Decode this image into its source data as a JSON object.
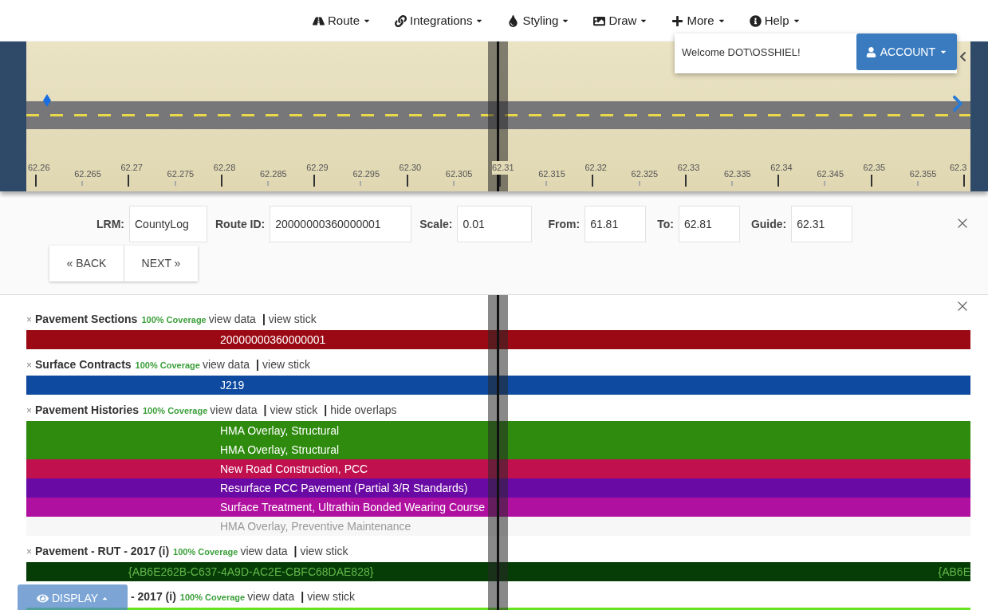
{
  "nav": [
    {
      "label": "Route"
    },
    {
      "label": "Integrations"
    },
    {
      "label": "Styling"
    },
    {
      "label": "Draw"
    },
    {
      "label": "More"
    },
    {
      "label": "Help"
    }
  ],
  "account": {
    "welcome": "Welcome DOT\\OSSHIEL!",
    "button": "ACCOUNT"
  },
  "map": {
    "ticks": [
      {
        "label": "62.26",
        "kind": "major"
      },
      {
        "label": "62.265",
        "kind": "minor"
      },
      {
        "label": "62.27",
        "kind": "major"
      },
      {
        "label": "62.275",
        "kind": "minor"
      },
      {
        "label": "62.28",
        "kind": "major"
      },
      {
        "label": "62.285",
        "kind": "minor"
      },
      {
        "label": "62.29",
        "kind": "major"
      },
      {
        "label": "62.295",
        "kind": "minor"
      },
      {
        "label": "62.30",
        "kind": "major"
      },
      {
        "label": "62.305",
        "kind": "minor"
      },
      {
        "label": "62.31",
        "kind": "major"
      },
      {
        "label": "62.315",
        "kind": "minor"
      },
      {
        "label": "62.32",
        "kind": "major"
      },
      {
        "label": "62.325",
        "kind": "minor"
      },
      {
        "label": "62.33",
        "kind": "major"
      },
      {
        "label": "62.335",
        "kind": "minor"
      },
      {
        "label": "62.34",
        "kind": "major"
      },
      {
        "label": "62.345",
        "kind": "minor"
      },
      {
        "label": "62.35",
        "kind": "major"
      },
      {
        "label": "62.355",
        "kind": "minor"
      },
      {
        "label": "62.3",
        "kind": "major"
      }
    ]
  },
  "form": {
    "fields": [
      {
        "label": "LRM:",
        "value": "CountyLog"
      },
      {
        "label": "Route ID:",
        "value": "20000000360000001"
      },
      {
        "label": "Scale:",
        "value": "0.01"
      },
      {
        "label": "From:",
        "value": "61.81"
      },
      {
        "label": "To:",
        "value": "62.81"
      },
      {
        "label": "Guide:",
        "value": "62.31"
      }
    ],
    "buttons": [
      "« BACK",
      "NEXT »"
    ]
  },
  "tracks": [
    {
      "remove": "×",
      "title": "Pavement Sections",
      "coverage": "100% Coverage",
      "links": [
        {
          "label": "view data"
        },
        {
          "separator": "|",
          "label": "view stick"
        }
      ],
      "bars": [
        {
          "label": "20000000360000001",
          "color": "#9b0a14",
          "faded": false
        }
      ]
    },
    {
      "remove": "×",
      "title": "Surface Contracts",
      "coverage": "100% Coverage",
      "links": [
        {
          "label": "view data"
        },
        {
          "separator": "|",
          "label": "view stick"
        }
      ],
      "bars": [
        {
          "label": "J219",
          "color": "#0d4aa0",
          "faded": false
        }
      ]
    },
    {
      "remove": "×",
      "title": "Pavement Histories",
      "coverage": "100% Coverage",
      "links": [
        {
          "label": "view data"
        },
        {
          "separator": "|",
          "label": "view stick"
        },
        {
          "separator": "|",
          "label": "hide overlaps"
        }
      ],
      "bars": [
        {
          "label": "HMA Overlay, Structural",
          "color": "#2e8b0e",
          "faded": false
        },
        {
          "label": "HMA Overlay, Structural",
          "color": "#2e8b0e",
          "faded": false
        },
        {
          "label": "New Road Construction, PCC",
          "color": "#c0104e",
          "faded": false
        },
        {
          "label": "Resurface PCC Pavement (Partial 3/R Standards)",
          "color": "#6a0aa4",
          "faded": false
        },
        {
          "label": "Surface Treatment, Ultrathin Bonded Wearing Course",
          "color": "#b010a0",
          "faded": false
        },
        {
          "label": "HMA Overlay, Preventive Maintenance",
          "color": "#f2f2f2",
          "faded": true
        }
      ]
    },
    {
      "remove": "×",
      "title": "Pavement - RUT - 2017 (i)",
      "coverage": "100% Coverage",
      "links": [
        {
          "label": "view data"
        },
        {
          "separator": "|",
          "label": "view stick"
        }
      ],
      "bars": [
        {
          "label": "{AB6E262B-C637-4A9D-AC2E-CBFC68DAE828}",
          "end_label": "{AB6E",
          "color": "#063d06",
          "faded": false
        }
      ]
    },
    {
      "title": "- 2017 (i)",
      "coverage": "100% Coverage",
      "links": [
        {
          "label": "view data"
        },
        {
          "separator": "|",
          "label": "view stick"
        }
      ],
      "bars": [
        {
          "color": "#66e422",
          "faded": false
        }
      ]
    }
  ],
  "display_button": "DISPLAY"
}
